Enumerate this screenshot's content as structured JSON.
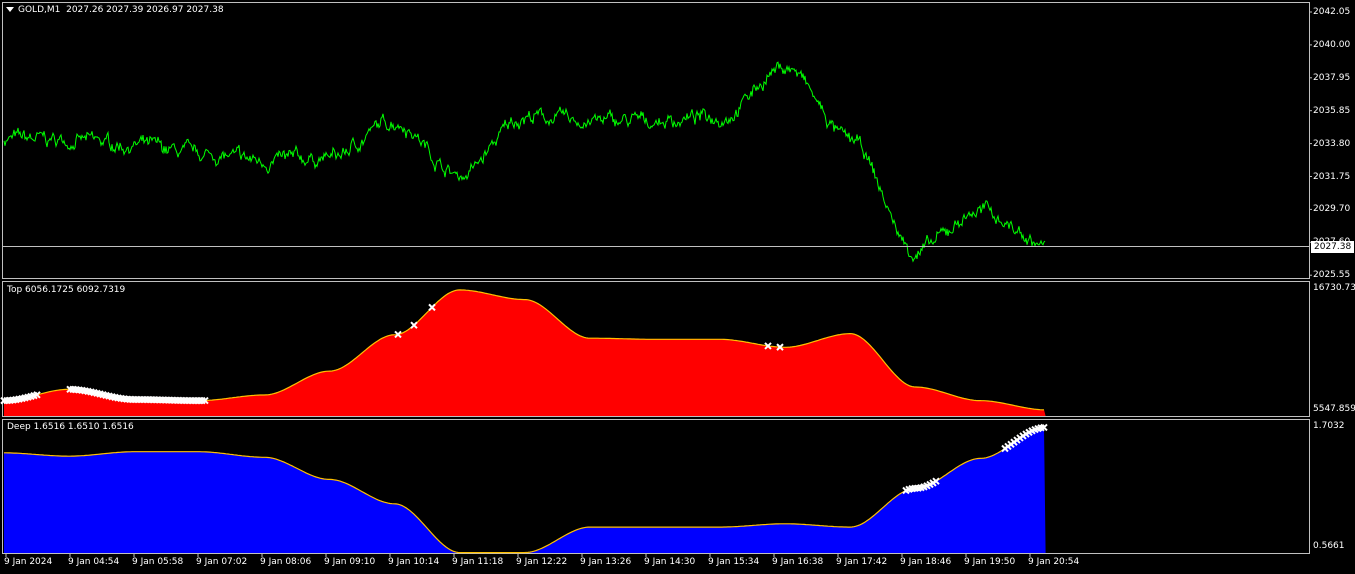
{
  "main_panel": {
    "symbol_label": "GOLD,M1",
    "ohlc_label": "2027.26 2027.39 2026.97 2027.38",
    "current_price": "2027.38",
    "price_ticks": [
      "2042.05",
      "2040.00",
      "2037.95",
      "2035.85",
      "2033.80",
      "2031.75",
      "2029.70",
      "2027.60",
      "2025.55"
    ],
    "line_color": "#00ff00"
  },
  "top_panel": {
    "label": "Top 6056.1725 6092.7319",
    "max_label": "16730.737",
    "min_label": "5547.8598",
    "fill_color": "#ff0000",
    "line_color": "#ffc000"
  },
  "deep_panel": {
    "label": "Deep 1.6516 1.6510 1.6516",
    "max_label": "1.7032",
    "min_label": "0.5661",
    "fill_color": "#0000ff",
    "line_color": "#ffc000"
  },
  "time_axis": [
    "9 Jan 2024",
    "9 Jan 04:54",
    "9 Jan 05:58",
    "9 Jan 07:02",
    "9 Jan 08:06",
    "9 Jan 09:10",
    "9 Jan 10:14",
    "9 Jan 11:18",
    "9 Jan 12:22",
    "9 Jan 13:26",
    "9 Jan 14:30",
    "9 Jan 15:34",
    "9 Jan 16:38",
    "9 Jan 17:42",
    "9 Jan 18:46",
    "9 Jan 19:50",
    "9 Jan 20:54"
  ],
  "chart_data": [
    {
      "type": "line",
      "title": "GOLD,M1",
      "x": [
        "9 Jan 2024",
        "9 Jan 04:54",
        "9 Jan 05:58",
        "9 Jan 07:02",
        "9 Jan 08:06",
        "9 Jan 09:10",
        "9 Jan 10:14",
        "9 Jan 11:18",
        "9 Jan 12:22",
        "9 Jan 13:26",
        "9 Jan 14:30",
        "9 Jan 15:34",
        "9 Jan 16:38",
        "9 Jan 17:42",
        "9 Jan 18:46",
        "9 Jan 19:50",
        "9 Jan 20:54"
      ],
      "series": [
        {
          "name": "GOLD,M1",
          "values": [
            2034.1,
            2034.0,
            2033.7,
            2033.1,
            2032.7,
            2032.9,
            2035.2,
            2031.8,
            2035.5,
            2035.2,
            2035.2,
            2035.5,
            2038.6,
            2034.0,
            2027.0,
            2029.6,
            2027.4
          ]
        }
      ],
      "ylim": [
        2025.55,
        2042.05
      ],
      "grid": false
    },
    {
      "type": "area",
      "title": "Top",
      "x": [
        "9 Jan 2024",
        "9 Jan 04:54",
        "9 Jan 05:58",
        "9 Jan 07:02",
        "9 Jan 08:06",
        "9 Jan 09:10",
        "9 Jan 10:14",
        "9 Jan 11:18",
        "9 Jan 12:22",
        "9 Jan 13:26",
        "9 Jan 14:30",
        "9 Jan 15:34",
        "9 Jan 16:38",
        "9 Jan 17:42",
        "9 Jan 18:46",
        "9 Jan 19:50",
        "9 Jan 20:54"
      ],
      "series": [
        {
          "name": "Top",
          "values": [
            6900,
            7900,
            7000,
            6900,
            7400,
            9500,
            12700,
            16650,
            15800,
            12400,
            12300,
            12300,
            11600,
            12800,
            8100,
            6900,
            6090
          ]
        }
      ],
      "ylim": [
        5547.8598,
        16730.737
      ]
    },
    {
      "type": "area",
      "title": "Deep",
      "x": [
        "9 Jan 2024",
        "9 Jan 04:54",
        "9 Jan 05:58",
        "9 Jan 07:02",
        "9 Jan 08:06",
        "9 Jan 09:10",
        "9 Jan 10:14",
        "9 Jan 11:18",
        "9 Jan 12:22",
        "9 Jan 13:26",
        "9 Jan 14:30",
        "9 Jan 15:34",
        "9 Jan 16:38",
        "9 Jan 17:42",
        "9 Jan 18:46",
        "9 Jan 19:50",
        "9 Jan 20:54"
      ],
      "series": [
        {
          "name": "Deep",
          "values": [
            1.47,
            1.44,
            1.48,
            1.48,
            1.43,
            1.23,
            1.01,
            0.57,
            0.57,
            0.8,
            0.8,
            0.8,
            0.83,
            0.8,
            1.15,
            1.42,
            1.7
          ]
        }
      ],
      "ylim": [
        0.5661,
        1.7032
      ]
    }
  ]
}
